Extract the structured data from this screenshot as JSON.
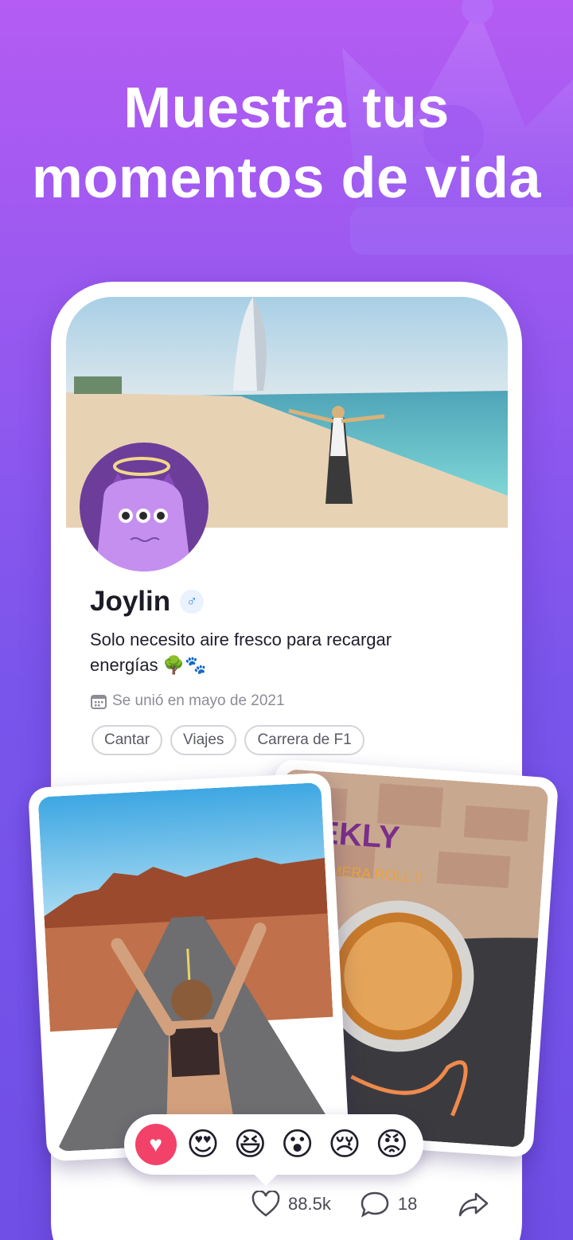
{
  "headline": {
    "line1": "Muestra tus",
    "line2": "momentos de vida"
  },
  "profile": {
    "name": "Joylin",
    "gender_symbol": "♂",
    "bio": "Solo necesito aire fresco para recargar energías 🌳🐾",
    "joined": "Se unió en mayo de 2021",
    "tags": [
      "Cantar",
      "Viajes",
      "Carrera de F1"
    ]
  },
  "post": {
    "overlay_text": "EEKLY",
    "overlay_subtext": "CAMERA ROLL !!",
    "likes": "88.5k",
    "comments": "18"
  },
  "reactions": [
    "heart",
    "😍",
    "😆",
    "😮",
    "😢",
    "😡"
  ],
  "colors": {
    "accent": "#7a55ec",
    "like": "#f2426a"
  }
}
